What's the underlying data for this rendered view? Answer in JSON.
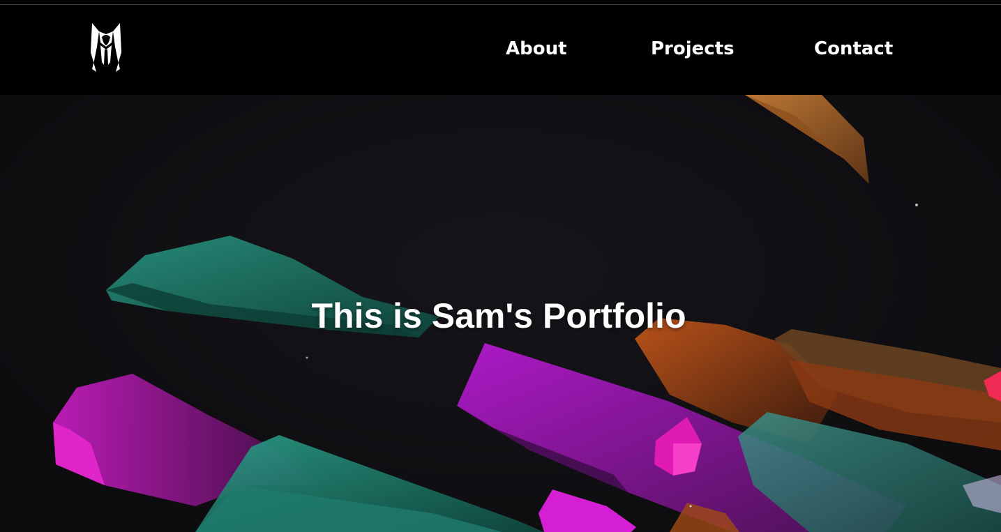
{
  "nav": {
    "logo": {
      "icon": "tuxedo-figure-logo-icon",
      "color": "#ffffff"
    },
    "links": [
      {
        "label": "About"
      },
      {
        "label": "Projects"
      },
      {
        "label": "Contact"
      }
    ]
  },
  "hero": {
    "title": "This is Sam's Portfolio",
    "background": "floating-crystal-shapes",
    "colors": {
      "background": "#0e0d10",
      "magenta": "#d21cc8",
      "teal": "#1f8f7a",
      "orange": "#d2691e"
    }
  }
}
